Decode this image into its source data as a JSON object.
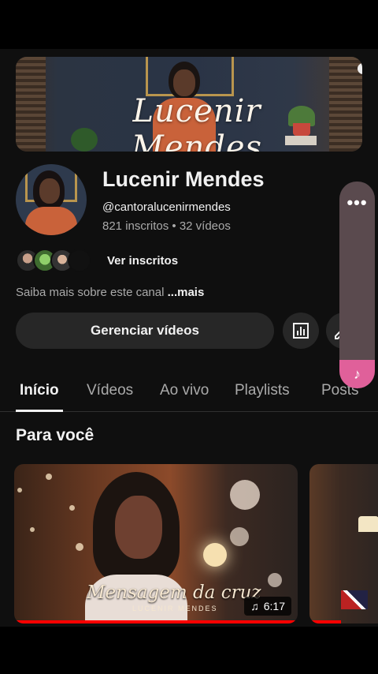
{
  "channel": {
    "banner_text": "Lucenir Mendes",
    "name": "Lucenir Mendes",
    "handle": "@cantoralucenirmendes",
    "subscribers": "821 inscritos",
    "separator": " • ",
    "videos": "32 vídeos",
    "view_subscribers": "Ver inscritos",
    "about_text": "Saiba mais sobre este canal",
    "about_more": "...mais"
  },
  "actions": {
    "manage_videos": "Gerenciar vídeos",
    "analytics_icon": "analytics-icon",
    "edit_icon": "edit-icon"
  },
  "floating_panel": {
    "more_icon": "more-dots-icon",
    "music_icon": "music-note-icon"
  },
  "tabs": [
    {
      "label": "Início",
      "active": true
    },
    {
      "label": "Vídeos",
      "active": false
    },
    {
      "label": "Ao vivo",
      "active": false
    },
    {
      "label": "Playlists",
      "active": false
    },
    {
      "label": "Posts",
      "active": false
    }
  ],
  "section": {
    "title": "Para você"
  },
  "videos": [
    {
      "overlay_title": "Mensagem da cruz",
      "overlay_sub": "LUCENIR MENDES",
      "duration": "6:17",
      "duration_icon": "music-note-icon"
    }
  ],
  "colors": {
    "background": "#0f0f0f",
    "button": "#272727",
    "accent_red": "#ff0000",
    "accent_pink": "#e0609a"
  }
}
